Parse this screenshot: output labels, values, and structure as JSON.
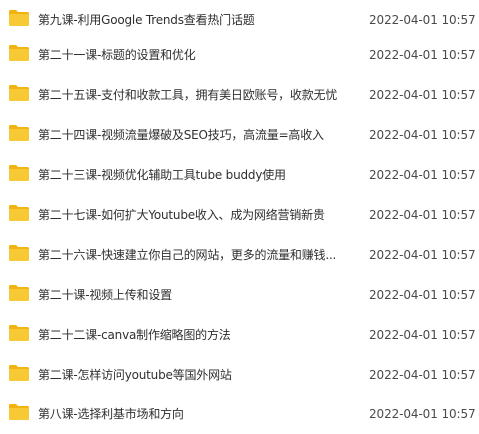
{
  "colors": {
    "folder_front": "#f7c934",
    "folder_back": "#f2b311",
    "text": "#2f2f2f",
    "date_text": "#4a4a4a"
  },
  "files": [
    {
      "icon": "folder-icon",
      "name": "第九课-利用Google Trends查看热门话题",
      "date": "2022-04-01 10:57"
    },
    {
      "icon": "folder-icon",
      "name": "第二十一课-标题的设置和优化",
      "date": "2022-04-01 10:57"
    },
    {
      "icon": "folder-icon",
      "name": "第二十五课-支付和收款工具，拥有美日欧账号，收款无忧",
      "date": "2022-04-01 10:57"
    },
    {
      "icon": "folder-icon",
      "name": "第二十四课-视频流量爆破及SEO技巧，高流量=高收入",
      "date": "2022-04-01 10:57"
    },
    {
      "icon": "folder-icon",
      "name": "第二十三课-视频优化辅助工具tube buddy使用",
      "date": "2022-04-01 10:57"
    },
    {
      "icon": "folder-icon",
      "name": "第二十七课-如何扩大Youtube收入、成为网络营销新贵",
      "date": "2022-04-01 10:57"
    },
    {
      "icon": "folder-icon",
      "name": "第二十六课-快速建立你自己的网站，更多的流量和赚钱...",
      "date": "2022-04-01 10:57"
    },
    {
      "icon": "folder-icon",
      "name": "第二十课-视频上传和设置",
      "date": "2022-04-01 10:57"
    },
    {
      "icon": "folder-icon",
      "name": "第二十二课-canva制作缩略图的方法",
      "date": "2022-04-01 10:57"
    },
    {
      "icon": "folder-icon",
      "name": "第二课-怎样访问youtube等国外网站",
      "date": "2022-04-01 10:57"
    },
    {
      "icon": "folder-icon",
      "name": "第八课-选择利基市场和方向",
      "date": "2022-04-01 10:57"
    }
  ]
}
